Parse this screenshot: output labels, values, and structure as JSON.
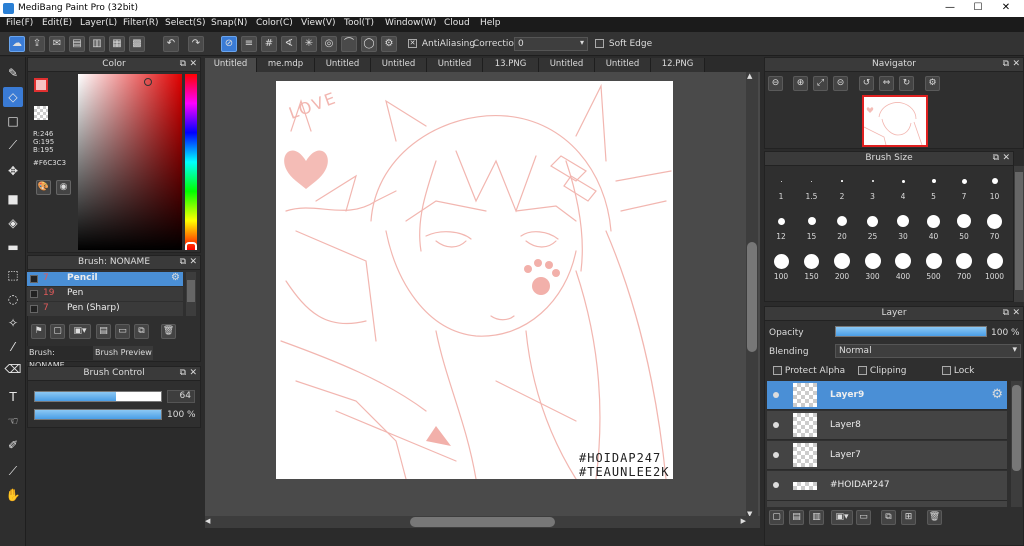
{
  "window": {
    "title": "MediBang Paint Pro (32bit)",
    "minimize": "—",
    "maximize": "☐",
    "close": "✕"
  },
  "menu": [
    "File(F)",
    "Edit(E)",
    "Layer(L)",
    "Filter(R)",
    "Select(S)",
    "Snap(N)",
    "Color(C)",
    "View(V)",
    "Tool(T)",
    "Window(W)",
    "Cloud",
    "Help"
  ],
  "toolbar": {
    "antialiasing_label": "AntiAliasing",
    "antialiasing_checked": true,
    "correction_label": "Correction",
    "correction_value": "0",
    "soft_edge_label": "Soft Edge",
    "soft_edge_checked": false
  },
  "color_panel": {
    "title": "Color",
    "r": "R:246",
    "g": "G:195",
    "b": "B:195",
    "hex": "#F6C3C3",
    "fg_color": "#F6C3C3",
    "bg_color": "#4ec6b0"
  },
  "brush_panel": {
    "title": "Brush: NONAME",
    "items": [
      {
        "size": "7",
        "name": "Pencil",
        "selected": true
      },
      {
        "size": "19",
        "name": "Pen",
        "selected": false
      },
      {
        "size": "7",
        "name": "Pen (Sharp)",
        "selected": false
      }
    ],
    "tab1": "Brush: NONAME",
    "tab2": "Brush Preview"
  },
  "brush_control": {
    "title": "Brush Control",
    "size": "64",
    "opacity": "100 %",
    "size_fraction": 0.64,
    "opacity_fraction": 1.0
  },
  "tabs": [
    "Untitled",
    "me.mdp",
    "Untitled",
    "Untitled",
    "Untitled",
    "13.PNG",
    "Untitled",
    "Untitled",
    "12.PNG"
  ],
  "active_tab": 0,
  "canvas": {
    "watermark_line1": "#HOIDAP247",
    "watermark_line2": "#TEAUNLEE2K",
    "doodle_text": "LOVE",
    "stroke_color": "#f2b6b0"
  },
  "navigator": {
    "title": "Navigator"
  },
  "brush_size": {
    "title": "Brush Size",
    "sizes": [
      "1",
      "1.5",
      "2",
      "3",
      "4",
      "5",
      "7",
      "10",
      "12",
      "15",
      "20",
      "25",
      "30",
      "40",
      "50",
      "70",
      "100",
      "150",
      "200",
      "300",
      "400",
      "500",
      "700",
      "1000"
    ]
  },
  "layer_panel": {
    "title": "Layer",
    "opacity_label": "Opacity",
    "opacity_value": "100 %",
    "opacity_fraction": 1.0,
    "blending_label": "Blending",
    "blending_value": "Normal",
    "protect_alpha": "Protect Alpha",
    "clipping": "Clipping",
    "lock": "Lock",
    "layers": [
      {
        "name": "Layer9",
        "selected": true
      },
      {
        "name": "Layer8",
        "selected": false
      },
      {
        "name": "Layer7",
        "selected": false
      },
      {
        "name": "#HOIDAP247",
        "selected": false
      }
    ]
  }
}
